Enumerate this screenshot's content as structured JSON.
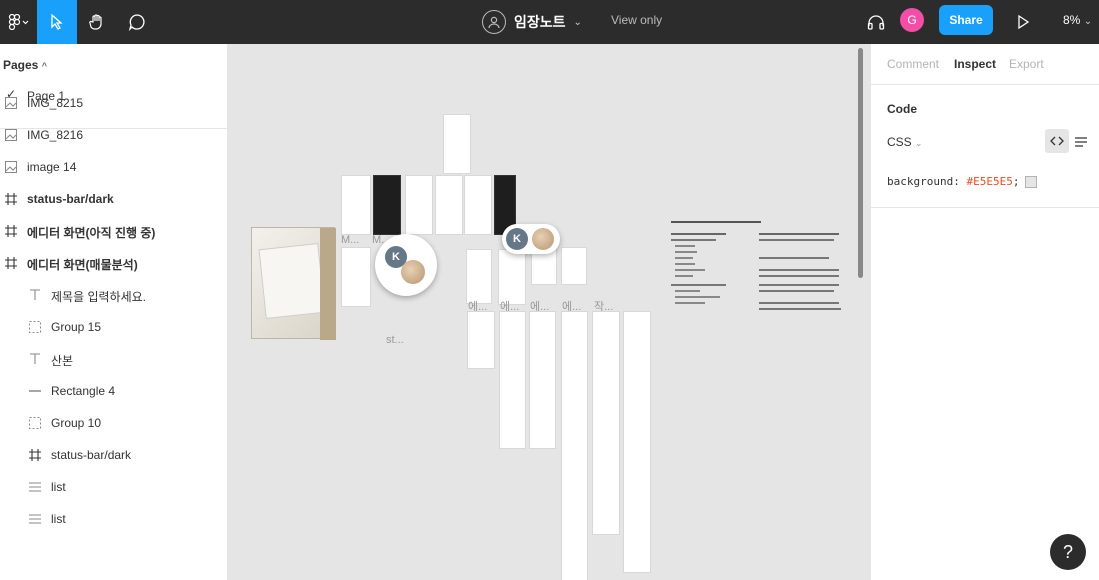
{
  "toolbar": {
    "file_name": "임장노트",
    "view_only": "View only",
    "user_initial": "G",
    "share_label": "Share",
    "zoom": "8%"
  },
  "pages_panel": {
    "heading": "Pages",
    "pages": [
      {
        "label": "Page 1",
        "selected": true
      }
    ]
  },
  "layers": [
    {
      "label": "IMG_8215",
      "icon": "image-icon"
    },
    {
      "label": "IMG_8216",
      "icon": "image-icon"
    },
    {
      "label": "image 14",
      "icon": "image-icon"
    },
    {
      "label": "status-bar/dark",
      "icon": "frame-icon"
    },
    {
      "label": "에디터 화면(아직 진행 중)",
      "icon": "frame-icon"
    },
    {
      "label": "에디터 화면(매물분석)",
      "icon": "frame-icon"
    },
    {
      "label": "제목을 입력하세요.",
      "icon": "text-icon"
    },
    {
      "label": "Group 15",
      "icon": "group-icon"
    },
    {
      "label": "산본",
      "icon": "text-icon"
    },
    {
      "label": "Rectangle 4",
      "icon": "rectangle-icon"
    },
    {
      "label": "Group 10",
      "icon": "group-icon"
    },
    {
      "label": "status-bar/dark",
      "icon": "frame-icon"
    },
    {
      "label": "list",
      "icon": "list-icon"
    },
    {
      "label": "list",
      "icon": "list-icon"
    }
  ],
  "canvas": {
    "background": "#E5E5E5",
    "frame_labels": [
      "M...",
      "M...",
      "st...",
      "에...",
      "에...",
      "에...",
      "에...",
      "작..."
    ],
    "cursor_initial": "K"
  },
  "inspect_panel": {
    "tabs": [
      "Comment",
      "Inspect",
      "Export"
    ],
    "active_tab": "Inspect",
    "code_heading": "Code",
    "language": "CSS",
    "code_property": "background:",
    "code_value": "#E5E5E5",
    "code_end": ";"
  },
  "help_label": "?",
  "colors": {
    "accent": "#18A0FB",
    "user": "#F24EA7",
    "toolbar": "#2C2C2C"
  }
}
